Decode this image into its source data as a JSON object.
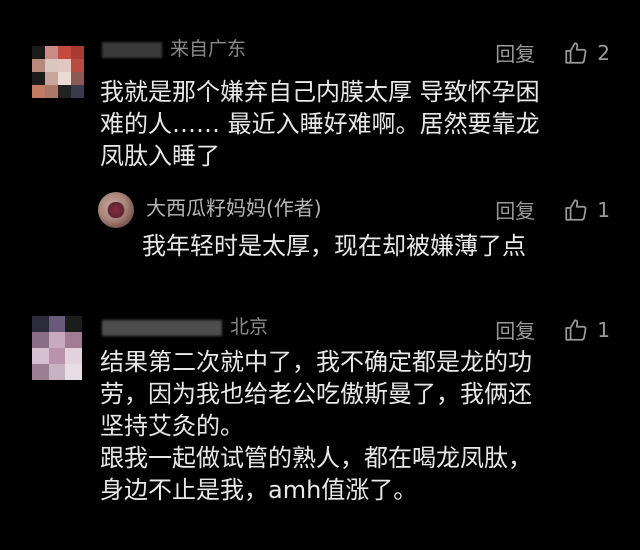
{
  "comments": [
    {
      "location": "来自广东",
      "reply_label": "回复",
      "likes": "2",
      "text_lines": [
        "我就是那个嫌弃自己内膜太厚 导致怀孕困",
        "难的人…… 最近入睡好难啊。居然要靠龙",
        "凤肽入睡了"
      ]
    },
    {
      "location": "北京",
      "reply_label": "回复",
      "likes": "1",
      "text_lines": [
        "结果第二次就中了，我不确定都是龙的功",
        "劳，因为我也给老公吃傲斯曼了，我俩还",
        "坚持艾灸的。",
        "跟我一起做试管的熟人，都在喝龙凤肽，",
        "身边不止是我，amh值涨了。"
      ]
    }
  ],
  "reply": {
    "author": "大西瓜籽妈妈(作者)",
    "reply_label": "回复",
    "likes": "1",
    "text": "我年轻时是太厚，现在却被嫌薄了点"
  },
  "colors": {
    "background": "#000000",
    "text": "#e8e8e8",
    "muted": "#8a8a8a"
  },
  "icons": {
    "like": "thumbs-up-outline"
  }
}
